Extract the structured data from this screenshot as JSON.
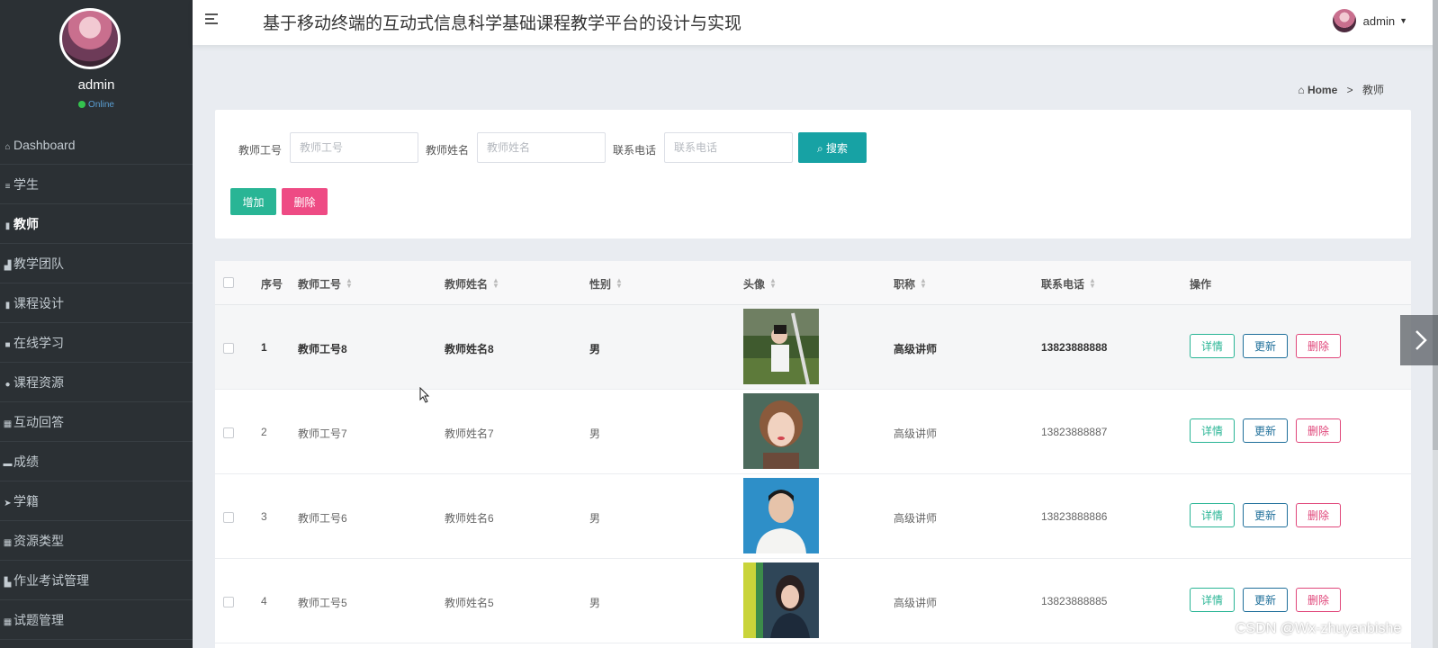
{
  "sidebar": {
    "user_name": "admin",
    "status": "Online",
    "items": [
      {
        "label": "Dashboard",
        "icon": "home-icon"
      },
      {
        "label": "学生",
        "icon": "list-icon"
      },
      {
        "label": "教师",
        "icon": "clipboard-icon",
        "active": true
      },
      {
        "label": "教学团队",
        "icon": "bar-chart-icon"
      },
      {
        "label": "课程设计",
        "icon": "clipboard-icon"
      },
      {
        "label": "在线学习",
        "icon": "square-icon"
      },
      {
        "label": "课程资源",
        "icon": "user-icon"
      },
      {
        "label": "互动回答",
        "icon": "grid-icon"
      },
      {
        "label": "成绩",
        "icon": "database-icon"
      },
      {
        "label": "学籍",
        "icon": "send-icon"
      },
      {
        "label": "资源类型",
        "icon": "grid-icon"
      },
      {
        "label": "作业考试管理",
        "icon": "chart-icon"
      },
      {
        "label": "试题管理",
        "icon": "grid-icon"
      }
    ]
  },
  "header": {
    "title": "基于移动终端的互动式信息科学基础课程教学平台的设计与实现",
    "user": "admin"
  },
  "breadcrumb": {
    "home": "Home",
    "separator": ">",
    "current": "教师"
  },
  "search": {
    "fields": [
      {
        "label": "教师工号",
        "placeholder": "教师工号"
      },
      {
        "label": "教师姓名",
        "placeholder": "教师姓名"
      },
      {
        "label": "联系电话",
        "placeholder": "联系电话"
      }
    ],
    "search_label": "搜索",
    "add_label": "增加",
    "delete_label": "删除"
  },
  "table": {
    "headers": [
      "序号",
      "教师工号",
      "教师姓名",
      "性别",
      "头像",
      "职称",
      "联系电话",
      "操作"
    ],
    "actions": {
      "detail": "详情",
      "update": "更新",
      "remove": "删除"
    },
    "rows": [
      {
        "index": "1",
        "id": "教师工号8",
        "name": "教师姓名8",
        "gender": "男",
        "title": "高级讲师",
        "phone": "13823888888"
      },
      {
        "index": "2",
        "id": "教师工号7",
        "name": "教师姓名7",
        "gender": "男",
        "title": "高级讲师",
        "phone": "13823888887"
      },
      {
        "index": "3",
        "id": "教师工号6",
        "name": "教师姓名6",
        "gender": "男",
        "title": "高级讲师",
        "phone": "13823888886"
      },
      {
        "index": "4",
        "id": "教师工号5",
        "name": "教师姓名5",
        "gender": "男",
        "title": "高级讲师",
        "phone": "13823888885"
      }
    ]
  },
  "watermark": "CSDN @Wx-zhuyanbishe",
  "colors": {
    "sidebar_bg": "#2b3034",
    "search_btn": "#17a2a4",
    "add_btn": "#29b595",
    "delete_btn": "#ee4b84"
  }
}
